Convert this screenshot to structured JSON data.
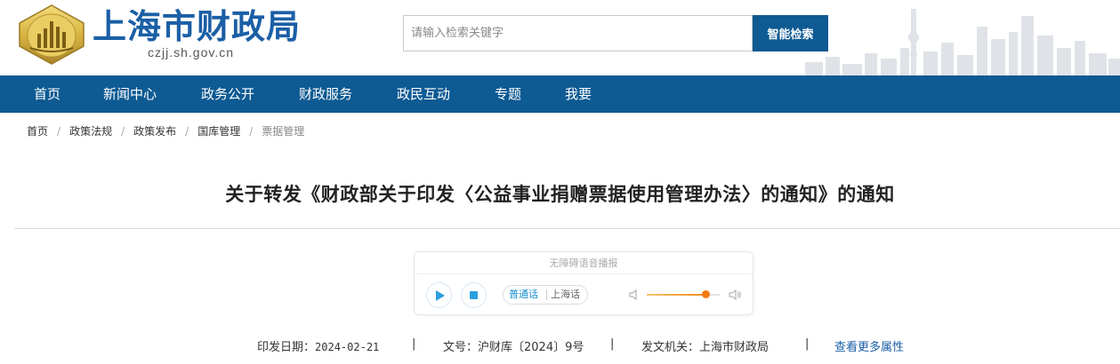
{
  "header": {
    "site_title": "上海市财政局",
    "site_domain": "czjj.sh.gov.cn",
    "search": {
      "placeholder": "请输入检索关键字",
      "value": "",
      "button_label": "智能检索"
    }
  },
  "nav": {
    "items": [
      {
        "label": "首页"
      },
      {
        "label": "新闻中心"
      },
      {
        "label": "政务公开"
      },
      {
        "label": "财政服务"
      },
      {
        "label": "政民互动"
      },
      {
        "label": "专题"
      },
      {
        "label": "我要"
      }
    ]
  },
  "breadcrumb": {
    "items": [
      {
        "label": "首页"
      },
      {
        "label": "政策法规"
      },
      {
        "label": "政策发布"
      },
      {
        "label": "国库管理"
      },
      {
        "label": "票据管理"
      }
    ],
    "separator": "/"
  },
  "article": {
    "title": "关于转发《财政部关于印发〈公益事业捐赠票据使用管理办法〉的通知》的通知"
  },
  "player": {
    "title": "无障碍语音播报",
    "lang_mandarin": "普通话",
    "lang_shanghainese": "上海话",
    "active_lang": "普通话",
    "volume_level": 0.8,
    "icons": {
      "play": "play-icon",
      "stop": "stop-icon",
      "volume_low": "volume-low-icon",
      "volume_high": "volume-high-icon"
    }
  },
  "meta": {
    "date_label": "印发日期：",
    "date_value": "2024-02-21",
    "doc_no_label": "文号：",
    "doc_no_value": "沪财库〔2024〕9号",
    "issuer_label": "发文机关：",
    "issuer_value": "上海市财政局",
    "more_link": "查看更多属性",
    "separator": "|"
  },
  "colors": {
    "brand_blue": "#0e5a93",
    "title_blue": "#1b5fa6",
    "accent_orange": "#f07a10",
    "player_blue": "#2aa0e0"
  }
}
